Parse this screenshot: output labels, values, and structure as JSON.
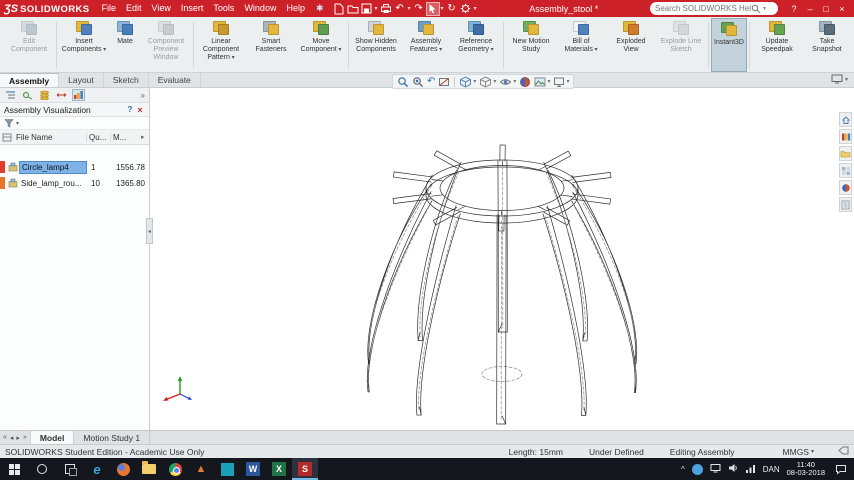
{
  "glyphs": {
    "caret_down": "▾",
    "undo_arrow": "↶",
    "redo_arrow": "↷",
    "rebuild": "↻",
    "pin": "✱",
    "help": "?",
    "minimize": "–",
    "maximize": "□",
    "close": "×",
    "prev_arrow": "◂",
    "next_arrow": "▸",
    "first": "«",
    "last": "»",
    "more": "»",
    "hidden_icons": "^"
  },
  "titlebar": {
    "logo_prefix": "ƷS",
    "logo_text": "SOLIDWORKS",
    "menus": [
      "File",
      "Edit",
      "View",
      "Insert",
      "Tools",
      "Window",
      "Help"
    ],
    "toolbar_icons": [
      "new-document",
      "open",
      "save",
      "print",
      "undo",
      "redo",
      "select-cursor",
      "rebuild",
      "options"
    ],
    "document_title": "Assembly_stool *",
    "search_placeholder": "Search SOLIDWORKS Help"
  },
  "commandmanager": {
    "active_tab": "Assembly",
    "tabs": [
      "Assembly",
      "Layout",
      "Sketch",
      "Evaluate"
    ],
    "items": [
      {
        "label": "Edit Component",
        "disabled": true,
        "dropdown": false
      },
      {
        "label": "Insert Components",
        "disabled": false,
        "dropdown": true
      },
      {
        "label": "Mate",
        "disabled": false,
        "dropdown": false
      },
      {
        "label": "Component Preview Window",
        "disabled": true,
        "dropdown": false
      },
      {
        "label": "Linear Component Pattern",
        "disabled": false,
        "dropdown": true
      },
      {
        "label": "Smart Fasteners",
        "disabled": false,
        "dropdown": false
      },
      {
        "label": "Move Component",
        "disabled": false,
        "dropdown": true
      },
      {
        "label": "Show Hidden Components",
        "disabled": false,
        "dropdown": false
      },
      {
        "label": "Assembly Features",
        "disabled": false,
        "dropdown": true
      },
      {
        "label": "Reference Geometry",
        "disabled": false,
        "dropdown": true
      },
      {
        "label": "New Motion Study",
        "disabled": false,
        "dropdown": false
      },
      {
        "label": "Bill of Materials",
        "disabled": false,
        "dropdown": true
      },
      {
        "label": "Exploded View",
        "disabled": false,
        "dropdown": false
      },
      {
        "label": "Explode Line Sketch",
        "disabled": true,
        "dropdown": false
      },
      {
        "label": "Instant3D",
        "disabled": false,
        "dropdown": false,
        "active": true
      },
      {
        "label": "Update Speedpak",
        "disabled": false,
        "dropdown": false
      },
      {
        "label": "Take Snapshot",
        "disabled": false,
        "dropdown": false
      }
    ]
  },
  "left_panel": {
    "title": "Assembly Visualization",
    "manager_tabs": [
      "featuremanager-design-tree",
      "propertymanager",
      "configurationmanager",
      "dimxpertmanager",
      "assembly-visualization"
    ],
    "columns": [
      "File Name",
      "Qu...",
      "M..."
    ],
    "rows": [
      {
        "name": "Circle_lamp4",
        "quantity": "1",
        "mass": "1556.78",
        "bar_color": "#de3b2d",
        "selected": true
      },
      {
        "name": "Side_lamp_rou...",
        "quantity": "10",
        "mass": "1365.80",
        "bar_color": "#e5742f",
        "selected": false
      }
    ]
  },
  "viewport": {
    "headsup_tools": [
      "zoom-to-fit",
      "zoom-to-area",
      "previous-view",
      "section-view",
      "view-orientation",
      "display-style",
      "hide-show-items",
      "edit-appearance",
      "apply-scene",
      "view-settings"
    ],
    "taskpane_tabs": [
      "solidworks-resources",
      "design-library",
      "file-explorer",
      "view-palette",
      "appearances",
      "custom-properties"
    ]
  },
  "model_tabs": {
    "tabs": [
      "Model",
      "Motion Study 1"
    ],
    "active": "Model"
  },
  "statusbar": {
    "edition": "SOLIDWORKS Student Edition - Academic Use Only",
    "measurement": "Length: 15mm",
    "constraint_state": "Under Defined",
    "mode": "Editing Assembly",
    "units": "MMGS"
  },
  "taskbar": {
    "apps": [
      {
        "name": "edge",
        "glyph": "e"
      },
      {
        "name": "firefox",
        "glyph": ""
      },
      {
        "name": "file-explorer",
        "glyph": ""
      },
      {
        "name": "chrome",
        "glyph": ""
      },
      {
        "name": "vlc",
        "glyph": "▲"
      },
      {
        "name": "photos",
        "glyph": ""
      },
      {
        "name": "word",
        "glyph": "W"
      },
      {
        "name": "excel",
        "glyph": "X"
      },
      {
        "name": "solidworks",
        "glyph": "S",
        "active": true
      }
    ],
    "tray": {
      "language": "DAN",
      "time": "11:40",
      "date": "08-03-2018"
    }
  }
}
